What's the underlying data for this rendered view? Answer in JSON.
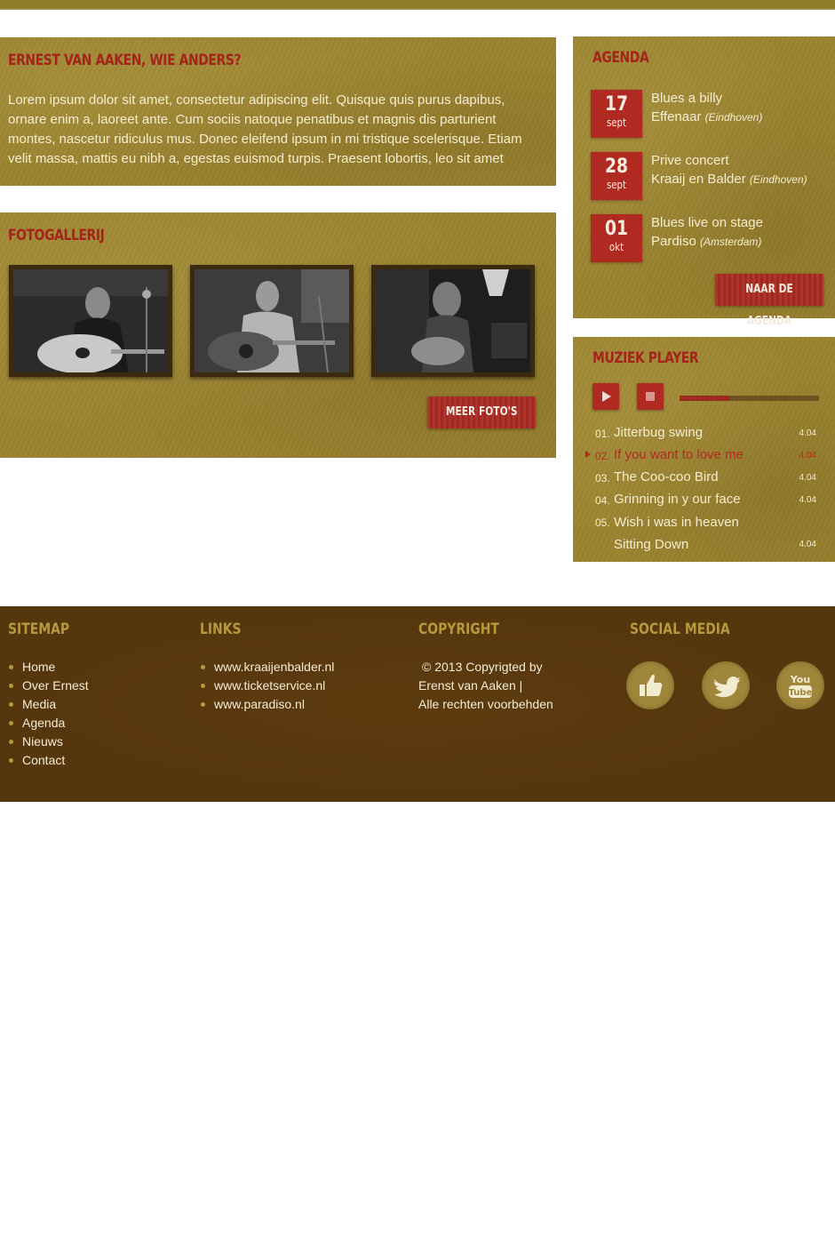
{
  "about": {
    "title": "Ernest van Aaken, wie anders?",
    "body": "Lorem ipsum dolor sit amet, consectetur adipiscing elit. Quisque quis purus dapibus, ornare enim a, laoreet ante. Cum sociis natoque penatibus et magnis dis parturient montes, nascetur ridiculus mus. Donec eleifend ipsum in mi tristique scelerisque. Etiam velit massa, mattis eu nibh a, egestas euismod turpis. Praesent lobortis, leo sit amet"
  },
  "gallery": {
    "title": "Fotogallerij",
    "more_label": "Meer foto's"
  },
  "agenda": {
    "title": "Agenda",
    "events": [
      {
        "day": "17",
        "month": "sept",
        "line1": "Blues a billy",
        "venue": "Effenaar",
        "location": "(Eindhoven)"
      },
      {
        "day": "28",
        "month": "sept",
        "line1": "Prive concert",
        "venue": "Kraaij en Balder",
        "location": "(Eindhoven)"
      },
      {
        "day": "01",
        "month": "okt",
        "line1": "Blues live on stage",
        "venue": "Pardiso",
        "location": "(Amsterdam)"
      }
    ],
    "button_label": "Naar de agenda"
  },
  "player": {
    "title": "Muziek player",
    "progress": 0.36,
    "tracks": [
      {
        "num": "01.",
        "title": "Jitterbug swing",
        "duration": "4.04"
      },
      {
        "num": "02.",
        "title": "If you want to love me",
        "duration": "4.04"
      },
      {
        "num": "03.",
        "title": "The Coo-coo Bird",
        "duration": "4.04"
      },
      {
        "num": "04.",
        "title": "Grinning in y our face",
        "duration": "4.04"
      },
      {
        "num": "05.",
        "title": "Wish i was in heaven Sitting Down",
        "duration": "4.04"
      }
    ]
  },
  "footer": {
    "sitemap_title": "Sitemap",
    "sitemap": [
      "Home",
      "Over Ernest",
      "Media",
      "Agenda",
      "Nieuws",
      "Contact"
    ],
    "links_title": "Links",
    "links": [
      "www.kraaijenbalder.nl",
      "www.ticketservice.nl",
      "www.paradiso.nl"
    ],
    "copyright_title": "Copyright",
    "copyright_lines": [
      "© 2013 Copyrigted by",
      "Erenst van Aaken |",
      "Alle rechten voorbehden"
    ],
    "social_title": "Social media",
    "social_icons": [
      "like-icon",
      "twitter-icon",
      "youtube-icon"
    ]
  },
  "colors": {
    "panel": "#9c8430",
    "accent_red": "#b02a22",
    "footer_bg": "#56360d",
    "footer_title": "#b59a3c",
    "text_light": "#f6edcf"
  }
}
